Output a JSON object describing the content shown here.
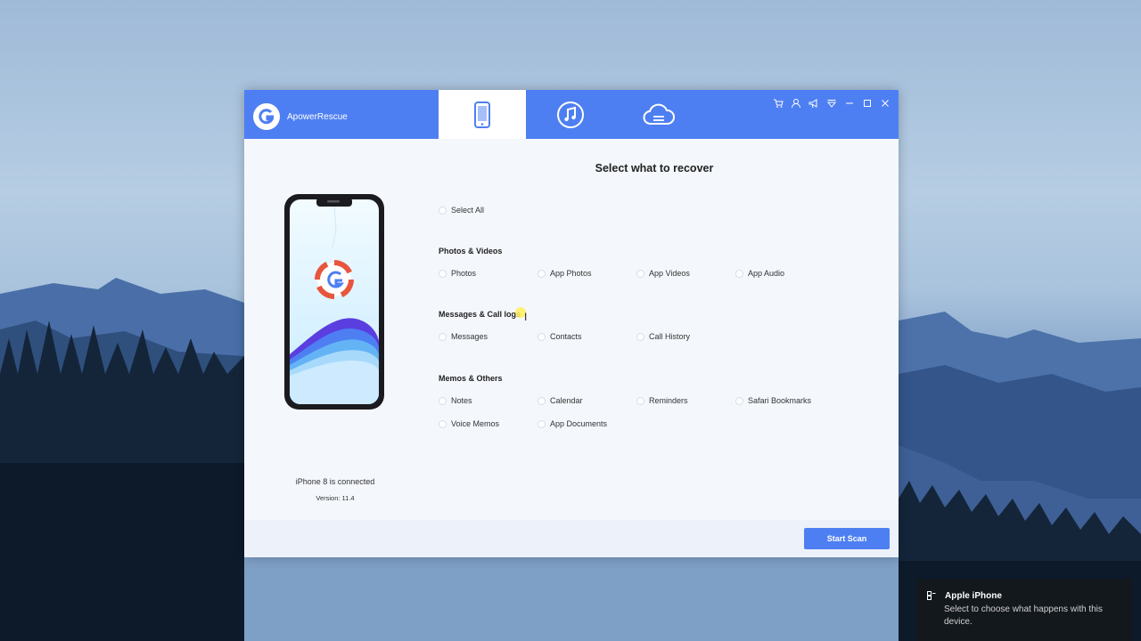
{
  "app": {
    "name": "ApowerRescue"
  },
  "tabs": [
    {
      "name": "Recover from iOS Device",
      "icon": "phone-icon",
      "active": true
    },
    {
      "name": "Recover from iTunes Backup",
      "icon": "music-note-icon",
      "active": false
    },
    {
      "name": "Recover from iCloud Backup",
      "icon": "cloud-icon",
      "active": false
    }
  ],
  "window_controls": [
    "cart-icon",
    "user-icon",
    "megaphone-icon",
    "dropdown-icon",
    "minimize-icon",
    "maximize-icon",
    "close-icon"
  ],
  "device": {
    "status": "iPhone 8 is connected",
    "version": "Version: 11.4"
  },
  "main": {
    "heading": "Select what to recover",
    "select_all": "Select All",
    "sections": [
      {
        "title": "Photos & Videos",
        "options": [
          "Photos",
          "App Photos",
          "App Videos",
          "App Audio"
        ]
      },
      {
        "title": "Messages & Call logs",
        "options": [
          "Messages",
          "Contacts",
          "Call History"
        ]
      },
      {
        "title": "Memos & Others",
        "options": [
          "Notes",
          "Calendar",
          "Reminders",
          "Safari Bookmarks",
          "Voice Memos",
          "App Documents"
        ]
      }
    ]
  },
  "footer": {
    "start_scan": "Start Scan"
  },
  "notification": {
    "title": "Apple iPhone",
    "body": "Select to choose what happens with this device."
  },
  "colors": {
    "accent": "#4e7ff2",
    "window_bg": "#f4f7fc",
    "footer_bg": "#edf1f9",
    "logo_red": "#e8553d"
  }
}
